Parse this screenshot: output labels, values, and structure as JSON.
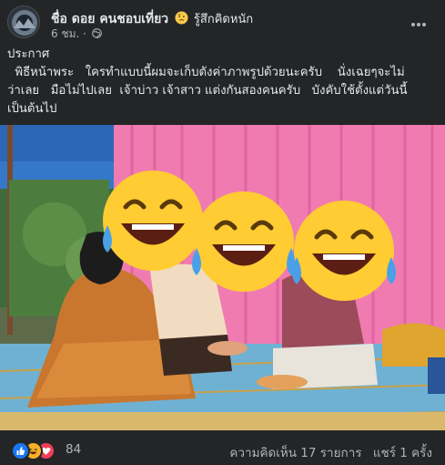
{
  "post": {
    "author": "ชื่อ ดอย คนชอบเที่ยว",
    "feeling": "รู้สึกคิดหนัก",
    "time": "6 ชม.",
    "separator": "·",
    "body_lines": [
      "ประกาศ",
      "  พิธีหน้าพระ   ใครทำแบบนี้ผมจะเก็บตังค่าภาพรูปด้วยนะครับ    นั่งเฉยๆจะไม่",
      "ว่าเลย   มือไม่ไปเลย  เจ้าบ่าว เจ้าสาว แต่งกันสองคนครับ   บังคับใช้ตั้งแต่วันนี้",
      "เป็นต้นไป"
    ]
  },
  "footer": {
    "reaction_icons": [
      "like-icon",
      "haha-icon",
      "love-icon"
    ],
    "reaction_count": "84",
    "comments": "ความคิดเห็น 17 รายการ",
    "shares": "แชร์ 1 ครั้ง"
  },
  "colors": {
    "background": "#242526",
    "text": "#e4e6eb",
    "secondary": "#b0b3b8",
    "like": "#1877f2",
    "love": "#f33e58",
    "haha": "#f7b125"
  }
}
